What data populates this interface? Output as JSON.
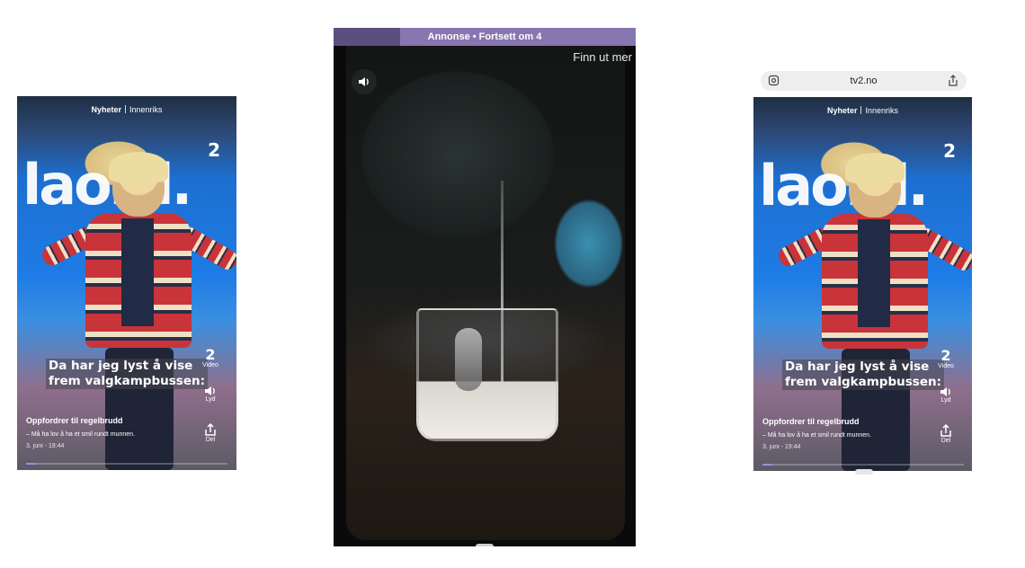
{
  "left_story": {
    "category": "Nyheter",
    "subcategory": "Innenriks",
    "bus_text": "laord.",
    "channel_logo": "2",
    "caption_line1": "Da har jeg lyst å vise",
    "caption_line2": "frem valgkampbussen:",
    "actions": {
      "video_label": "Video",
      "video_icon": "2",
      "sound_label": "Lyd",
      "share_label": "Del"
    },
    "title": "Oppfordrer til regelbrudd",
    "subtitle": "– Må ha lov å ha et smil rundt munnen.",
    "date": "3. juni - 19:44",
    "progress": 0.05
  },
  "ad": {
    "banner": "Annonse • Fortsett om 4",
    "cta": "Finn ut mer",
    "progress": 0.22
  },
  "right_story": {
    "url": "tv2.no",
    "category": "Nyheter",
    "subcategory": "Innenriks",
    "bus_text": "laord.",
    "channel_logo": "2",
    "caption_line1": "Da har jeg lyst å vise",
    "caption_line2": "frem valgkampbussen:",
    "actions": {
      "video_label": "Video",
      "video_icon": "2",
      "sound_label": "Lyd",
      "share_label": "Del"
    },
    "title": "Oppfordrer til regelbrudd",
    "subtitle": "– Må ha lov å ha et smil rundt munnen.",
    "date": "3. juni - 19:44",
    "progress": 0.05
  },
  "icons": [
    "speaker-icon",
    "share-icon",
    "page-settings-icon"
  ],
  "colors": {
    "accent": "#8876b0",
    "progress": "#9a8fd8"
  }
}
